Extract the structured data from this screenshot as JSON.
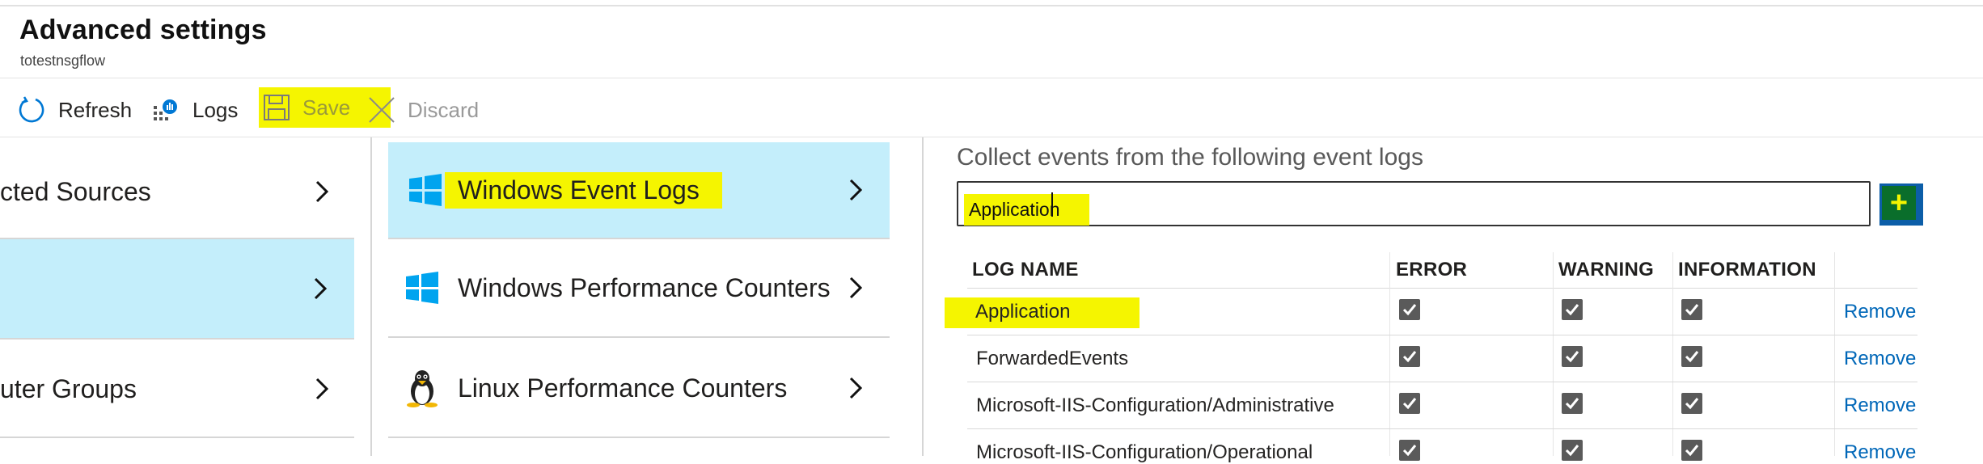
{
  "header": {
    "title": "Advanced settings",
    "subtitle": "totestnsgflow"
  },
  "toolbar": {
    "refresh_label": "Refresh",
    "logs_label": "Logs",
    "save_label": "Save",
    "discard_label": "Discard"
  },
  "left_nav": {
    "items": [
      {
        "label": "cted Sources"
      },
      {
        "label": ""
      },
      {
        "label": "uter Groups"
      }
    ]
  },
  "middle_nav": {
    "items": [
      {
        "label": "Windows Event Logs",
        "icon": "windows-icon"
      },
      {
        "label": "Windows Performance Counters",
        "icon": "windows-icon"
      },
      {
        "label": "Linux Performance Counters",
        "icon": "linux-penguin-icon"
      }
    ]
  },
  "event_logs": {
    "collect_label": "Collect events from the following event logs",
    "input_value": "Application",
    "add_button_label": "+",
    "columns": [
      "LOG NAME",
      "ERROR",
      "WARNING",
      "INFORMATION"
    ],
    "rows": [
      {
        "name": "Application",
        "error": true,
        "warning": true,
        "information": true,
        "action": "Remove"
      },
      {
        "name": "ForwardedEvents",
        "error": true,
        "warning": true,
        "information": true,
        "action": "Remove"
      },
      {
        "name": "Microsoft-IIS-Configuration/Administrative",
        "error": true,
        "warning": true,
        "information": true,
        "action": "Remove"
      },
      {
        "name": "Microsoft-IIS-Configuration/Operational",
        "error": true,
        "warning": true,
        "information": true,
        "action": "Remove"
      }
    ]
  },
  "colors": {
    "selection_bg": "#c4eefb",
    "highlight": "#f5f500",
    "link": "#0067b8",
    "windows_logo": "#00a4ef"
  }
}
